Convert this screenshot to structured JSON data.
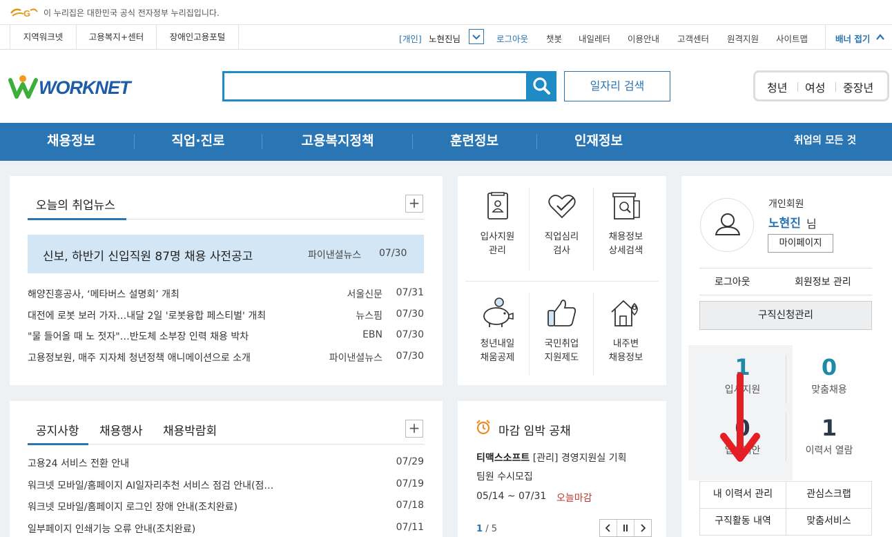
{
  "gov_banner": {
    "text": "이 누리집은 대한민국 공식 전자정부 누리집입니다."
  },
  "util_nav": {
    "left_links": [
      "지역워크넷",
      "고용복지+센터",
      "장애인고용포털"
    ],
    "user_type": "[개인]",
    "user_name": "노현진님",
    "right_links": [
      "로그아웃",
      "챗봇",
      "내일레터",
      "이용안내",
      "고객센터",
      "원격지원",
      "사이트맵"
    ],
    "banner_toggle": "배너 접기"
  },
  "header": {
    "logo_text": "WORKNET",
    "search": {
      "placeholder": "",
      "value": ""
    },
    "job_search_button": "일자리 검색",
    "age_tabs": [
      "청년",
      "여성",
      "중장년"
    ]
  },
  "main_nav": {
    "items": [
      "채용정보",
      "직업·진로",
      "고용복지정책",
      "훈련정보",
      "인재정보"
    ],
    "right_link": "취업의 모든 것"
  },
  "news": {
    "tab": "오늘의 취업뉴스",
    "headline": {
      "title": "신보, 하반기 신입직원 87명 채용 사전공고",
      "source": "파이낸셜뉴스",
      "date": "07/30"
    },
    "items": [
      {
        "title": "해양진흥공사, ‘메타버스 설명회’ 개최",
        "source": "서울신문",
        "date": "07/31"
      },
      {
        "title": "대전에 로봇 보러 가자…내달 2일 '로봇융합 페스티벌' 개최",
        "source": "뉴스핌",
        "date": "07/30"
      },
      {
        "title": "\"물 들어올 때 노 젓자\"…반도체 소부장 인력 채용 박차",
        "source": "EBN",
        "date": "07/30"
      },
      {
        "title": "고용정보원, 매주 지자체 청년정책 애니메이션으로 소개",
        "source": "파이낸셜뉴스",
        "date": "07/30"
      }
    ]
  },
  "notices": {
    "tabs": [
      "공지사항",
      "채용행사",
      "채용박람회"
    ],
    "items": [
      {
        "title": "고용24 서비스 전환 안내",
        "date": "07/29"
      },
      {
        "title": "워크넷 모바일/홈페이지 AI일자리추천 서비스 점검 안내(점…",
        "date": "07/19"
      },
      {
        "title": "워크넷 모바일/홈페이지 로그인 장애 안내(조치완료)",
        "date": "07/18"
      },
      {
        "title": "일부페이지 인쇄기능 오류 안내(조치완료)",
        "date": "07/11"
      }
    ]
  },
  "services": [
    {
      "line1": "입사지원",
      "line2": "관리",
      "icon": "resume-icon"
    },
    {
      "line1": "직업심리",
      "line2": "검사",
      "icon": "heart-check-icon"
    },
    {
      "line1": "채용정보",
      "line2": "상세검색",
      "icon": "document-search-icon"
    },
    {
      "line1": "청년내일",
      "line2": "채움공제",
      "icon": "piggy-bank-icon"
    },
    {
      "line1": "국민취업",
      "line2": "지원제도",
      "icon": "thumbs-up-icon"
    },
    {
      "line1": "내주변",
      "line2": "채용정보",
      "icon": "house-location-icon"
    }
  ],
  "deadline": {
    "title": "마감 임박 공채",
    "company": "티맥스소프트",
    "job": "[관리] 경영지원실 기획팀원 수시모집",
    "job_line1": "[관리] 경영지원실 기획",
    "job_line2": "팀원 수시모집",
    "period": "05/14 ~ 07/31",
    "status": "오늘마감",
    "page_current": "1",
    "page_total": "/ 5"
  },
  "member": {
    "type": "개인회원",
    "name": "노현진",
    "suffix": "님",
    "mypage": "마이페이지",
    "logout": "로그아웃",
    "manage": "회원정보 관리",
    "job_apply_manage": "구직신청관리",
    "stats": [
      {
        "value": "1",
        "label": "입사지원"
      },
      {
        "value": "0",
        "label": "맞춤채용"
      },
      {
        "value": "0",
        "label": "입사제안"
      },
      {
        "value": "1",
        "label": "이력서 열람"
      }
    ],
    "grid": [
      "내 이력서 관리",
      "관심스크랩",
      "구직활동 내역",
      "맞춤서비스"
    ]
  },
  "colors": {
    "brand_blue": "#2a75b4",
    "accent_blue": "#1f8bc6",
    "highlight_bg": "#d3e6f6",
    "deadline_red": "#c0392b",
    "arrow_red": "#e31e24"
  }
}
